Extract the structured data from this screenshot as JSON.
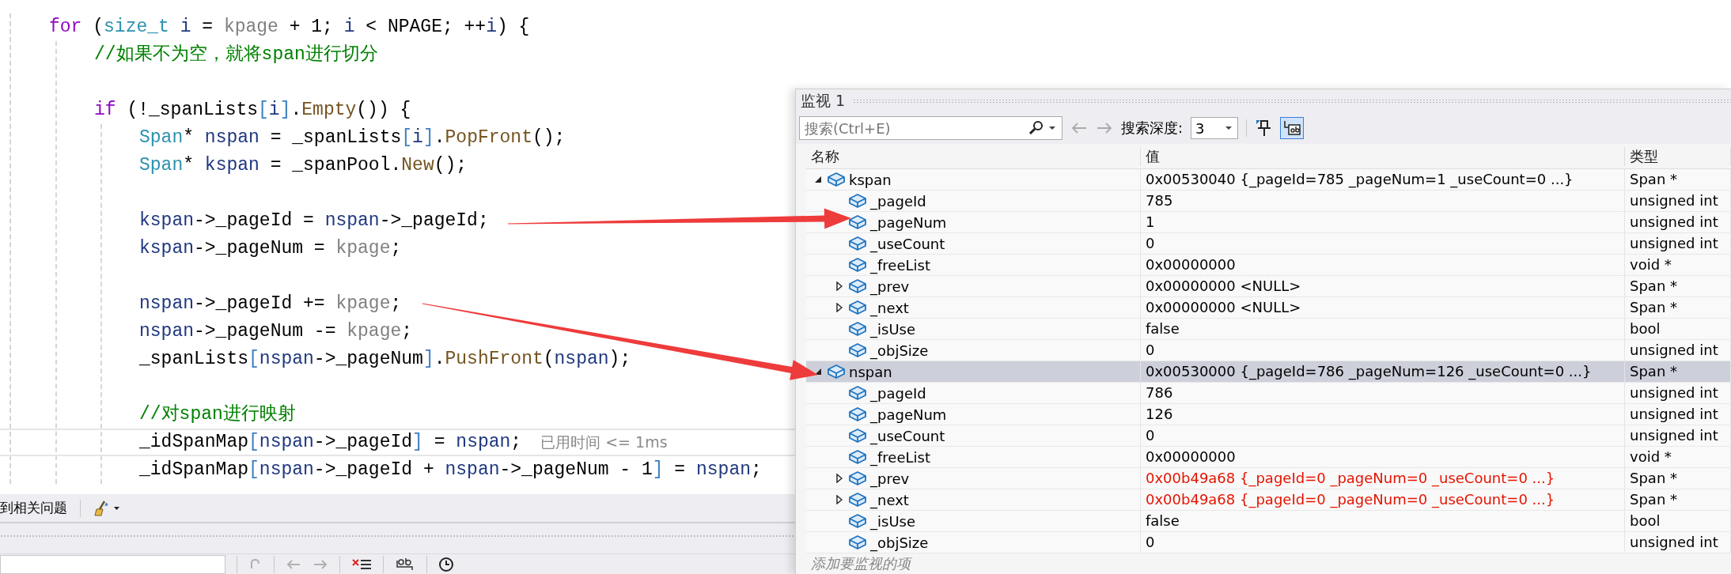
{
  "code": [
    {
      "current": false,
      "tokens": [
        {
          "kind": "kw",
          "s": "for"
        },
        {
          "kind": "p",
          "s": " ("
        },
        {
          "kind": "type",
          "s": "size_t"
        },
        {
          "kind": "local",
          "s": " i"
        },
        {
          "kind": "p",
          "s": " = "
        },
        {
          "kind": "param",
          "s": "kpage"
        },
        {
          "kind": "p",
          "s": " + 1; "
        },
        {
          "kind": "local",
          "s": "i"
        },
        {
          "kind": "p",
          "s": " < NPAGE; ++"
        },
        {
          "kind": "local",
          "s": "i"
        },
        {
          "kind": "p",
          "s": ") {"
        }
      ],
      "children": [
        {
          "current": false,
          "tokens": [
            {
              "kind": "comment",
              "s": "//如果不为空，就将span进行切分"
            }
          ]
        },
        {
          "kind": "blank"
        },
        {
          "current": false,
          "tokens": [
            {
              "kind": "kw",
              "s": "if"
            },
            {
              "kind": "p",
              "s": " (!_spanLists"
            },
            {
              "kind": "op",
              "s": "["
            },
            {
              "kind": "local",
              "s": "i"
            },
            {
              "kind": "op",
              "s": "]"
            },
            {
              "kind": "p",
              "s": "."
            },
            {
              "kind": "func",
              "s": "Empty"
            },
            {
              "kind": "p",
              "s": "()) {"
            }
          ],
          "children": [
            {
              "current": false,
              "tokens": [
                {
                  "kind": "type",
                  "s": "Span"
                },
                {
                  "kind": "p",
                  "s": "* "
                },
                {
                  "kind": "local",
                  "s": "nspan"
                },
                {
                  "kind": "p",
                  "s": " = _spanLists"
                },
                {
                  "kind": "op",
                  "s": "["
                },
                {
                  "kind": "local",
                  "s": "i"
                },
                {
                  "kind": "op",
                  "s": "]"
                },
                {
                  "kind": "p",
                  "s": "."
                },
                {
                  "kind": "func",
                  "s": "PopFront"
                },
                {
                  "kind": "p",
                  "s": "();"
                }
              ]
            },
            {
              "current": false,
              "tokens": [
                {
                  "kind": "type",
                  "s": "Span"
                },
                {
                  "kind": "p",
                  "s": "* "
                },
                {
                  "kind": "local",
                  "s": "kspan"
                },
                {
                  "kind": "p",
                  "s": " = _spanPool."
                },
                {
                  "kind": "func",
                  "s": "New"
                },
                {
                  "kind": "p",
                  "s": "();"
                }
              ]
            },
            {
              "kind": "blank"
            },
            {
              "current": false,
              "tokens": [
                {
                  "kind": "local",
                  "s": "kspan"
                },
                {
                  "kind": "p",
                  "s": "->_pageId = "
                },
                {
                  "kind": "local",
                  "s": "nspan"
                },
                {
                  "kind": "p",
                  "s": "->_pageId;"
                }
              ]
            },
            {
              "current": false,
              "tokens": [
                {
                  "kind": "local",
                  "s": "kspan"
                },
                {
                  "kind": "p",
                  "s": "->_pageNum = "
                },
                {
                  "kind": "param",
                  "s": "kpage"
                },
                {
                  "kind": "p",
                  "s": ";"
                }
              ]
            },
            {
              "kind": "blank"
            },
            {
              "current": false,
              "tokens": [
                {
                  "kind": "local",
                  "s": "nspan"
                },
                {
                  "kind": "p",
                  "s": "->_pageId += "
                },
                {
                  "kind": "param",
                  "s": "kpage"
                },
                {
                  "kind": "p",
                  "s": ";"
                }
              ]
            },
            {
              "current": false,
              "tokens": [
                {
                  "kind": "local",
                  "s": "nspan"
                },
                {
                  "kind": "p",
                  "s": "->_pageNum -= "
                },
                {
                  "kind": "param",
                  "s": "kpage"
                },
                {
                  "kind": "p",
                  "s": ";"
                }
              ]
            },
            {
              "current": false,
              "tokens": [
                {
                  "kind": "p",
                  "s": "_spanLists"
                },
                {
                  "kind": "op",
                  "s": "["
                },
                {
                  "kind": "local",
                  "s": "nspan"
                },
                {
                  "kind": "p",
                  "s": "->_pageNum"
                },
                {
                  "kind": "op",
                  "s": "]"
                },
                {
                  "kind": "p",
                  "s": "."
                },
                {
                  "kind": "func",
                  "s": "PushFront"
                },
                {
                  "kind": "p",
                  "s": "("
                },
                {
                  "kind": "local",
                  "s": "nspan"
                },
                {
                  "kind": "p",
                  "s": ");"
                }
              ]
            },
            {
              "kind": "blank"
            },
            {
              "current": false,
              "tokens": [
                {
                  "kind": "comment",
                  "s": "//对span进行映射"
                }
              ]
            },
            {
              "current": true,
              "hint": "已用时间 <= 1ms",
              "tokens": [
                {
                  "kind": "p",
                  "s": "_idSpanMap"
                },
                {
                  "kind": "op",
                  "s": "["
                },
                {
                  "kind": "local",
                  "s": "nspan"
                },
                {
                  "kind": "p",
                  "s": "->_pageId"
                },
                {
                  "kind": "op",
                  "s": "]"
                },
                {
                  "kind": "p",
                  "s": " = "
                },
                {
                  "kind": "local",
                  "s": "nspan"
                },
                {
                  "kind": "p",
                  "s": ";"
                }
              ]
            },
            {
              "current": false,
              "tokens": [
                {
                  "kind": "p",
                  "s": "_idSpanMap"
                },
                {
                  "kind": "op",
                  "s": "["
                },
                {
                  "kind": "local",
                  "s": "nspan"
                },
                {
                  "kind": "p",
                  "s": "->_pageId + "
                },
                {
                  "kind": "local",
                  "s": "nspan"
                },
                {
                  "kind": "p",
                  "s": "->_pageNum - 1"
                },
                {
                  "kind": "op",
                  "s": "]"
                },
                {
                  "kind": "p",
                  "s": " = "
                },
                {
                  "kind": "local",
                  "s": "nspan"
                },
                {
                  "kind": "p",
                  "s": ";"
                }
              ]
            }
          ]
        }
      ]
    }
  ],
  "error_bar": {
    "label": "到相关问题"
  },
  "watch": {
    "title": "监视 1",
    "search": {
      "placeholder": "搜索(Ctrl+E)"
    },
    "depth_label": "搜索深度:",
    "depth_value": "3",
    "columns": [
      "名称",
      "值",
      "类型"
    ],
    "rows": [
      {
        "name": "kspan",
        "value": "0x00530040 {_pageId=785 _pageNum=1 _useCount=0 ...}",
        "type": "Span *",
        "kind": "node",
        "expanded": true,
        "selected": false,
        "changed": false,
        "children": [
          {
            "name": "_pageId",
            "value": "785",
            "type": "unsigned int",
            "kind": "leaf",
            "selected": false,
            "changed": false
          },
          {
            "name": "_pageNum",
            "value": "1",
            "type": "unsigned int",
            "kind": "leaf",
            "selected": false,
            "changed": false
          },
          {
            "name": "_useCount",
            "value": "0",
            "type": "unsigned int",
            "kind": "leaf",
            "selected": false,
            "changed": false
          },
          {
            "name": "_freeList",
            "value": "0x00000000",
            "type": "void *",
            "kind": "leaf",
            "selected": false,
            "changed": false
          },
          {
            "name": "_prev",
            "value": "0x00000000 <NULL>",
            "type": "Span *",
            "kind": "node",
            "expanded": false,
            "selected": false,
            "changed": false
          },
          {
            "name": "_next",
            "value": "0x00000000 <NULL>",
            "type": "Span *",
            "kind": "node",
            "expanded": false,
            "selected": false,
            "changed": false
          },
          {
            "name": "_isUse",
            "value": "false",
            "type": "bool",
            "kind": "leaf",
            "selected": false,
            "changed": false
          },
          {
            "name": "_objSize",
            "value": "0",
            "type": "unsigned int",
            "kind": "leaf",
            "selected": false,
            "changed": false
          }
        ]
      },
      {
        "name": "nspan",
        "value": "0x00530000 {_pageId=786 _pageNum=126 _useCount=0 ...}",
        "type": "Span *",
        "kind": "node",
        "expanded": true,
        "selected": true,
        "changed": false,
        "children": [
          {
            "name": "_pageId",
            "value": "786",
            "type": "unsigned int",
            "kind": "leaf",
            "selected": false,
            "changed": false
          },
          {
            "name": "_pageNum",
            "value": "126",
            "type": "unsigned int",
            "kind": "leaf",
            "selected": false,
            "changed": false
          },
          {
            "name": "_useCount",
            "value": "0",
            "type": "unsigned int",
            "kind": "leaf",
            "selected": false,
            "changed": false
          },
          {
            "name": "_freeList",
            "value": "0x00000000",
            "type": "void *",
            "kind": "leaf",
            "selected": false,
            "changed": false
          },
          {
            "name": "_prev",
            "value": "0x00b49a68 {_pageId=0 _pageNum=0 _useCount=0 ...}",
            "type": "Span *",
            "kind": "node",
            "expanded": false,
            "selected": false,
            "changed": true
          },
          {
            "name": "_next",
            "value": "0x00b49a68 {_pageId=0 _pageNum=0 _useCount=0 ...}",
            "type": "Span *",
            "kind": "node",
            "expanded": false,
            "selected": false,
            "changed": true
          },
          {
            "name": "_isUse",
            "value": "false",
            "type": "bool",
            "kind": "leaf",
            "selected": false,
            "changed": false
          },
          {
            "name": "_objSize",
            "value": "0",
            "type": "unsigned int",
            "kind": "leaf",
            "selected": false,
            "changed": false
          }
        ]
      }
    ],
    "add_placeholder": "添加要监视的项"
  }
}
